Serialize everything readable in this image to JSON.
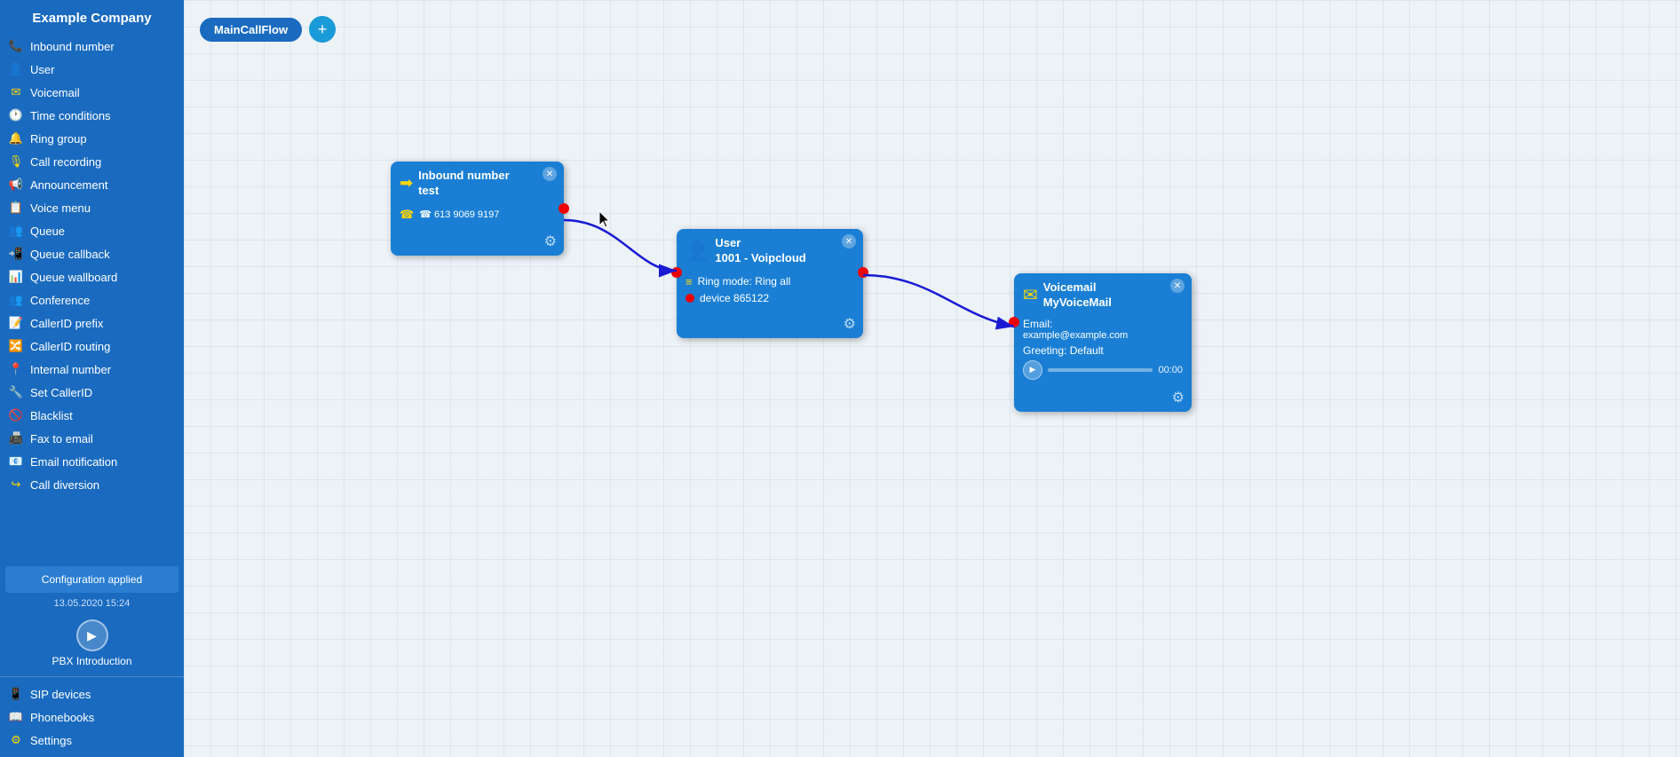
{
  "sidebar": {
    "title": "Example Company",
    "nav_items": [
      {
        "id": "inbound-number",
        "label": "Inbound number",
        "icon": "📞"
      },
      {
        "id": "user",
        "label": "User",
        "icon": "👤"
      },
      {
        "id": "voicemail",
        "label": "Voicemail",
        "icon": "✉"
      },
      {
        "id": "time-conditions",
        "label": "Time conditions",
        "icon": "🕐"
      },
      {
        "id": "ring-group",
        "label": "Ring group",
        "icon": "🔔"
      },
      {
        "id": "call-recording",
        "label": "Call recording",
        "icon": "🎙"
      },
      {
        "id": "announcement",
        "label": "Announcement",
        "icon": "📢"
      },
      {
        "id": "voice-menu",
        "label": "Voice menu",
        "icon": "📋"
      },
      {
        "id": "queue",
        "label": "Queue",
        "icon": "👥"
      },
      {
        "id": "queue-callback",
        "label": "Queue callback",
        "icon": "📲"
      },
      {
        "id": "queue-wallboard",
        "label": "Queue wallboard",
        "icon": "📊"
      },
      {
        "id": "conference",
        "label": "Conference",
        "icon": "👥"
      },
      {
        "id": "callerid-prefix",
        "label": "CallerID prefix",
        "icon": "📝"
      },
      {
        "id": "callerid-routing",
        "label": "CallerID routing",
        "icon": "🔀"
      },
      {
        "id": "internal-number",
        "label": "Internal number",
        "icon": "📍"
      },
      {
        "id": "set-callerid",
        "label": "Set CallerID",
        "icon": "🔧"
      },
      {
        "id": "blacklist",
        "label": "Blacklist",
        "icon": "🚫"
      },
      {
        "id": "fax-to-email",
        "label": "Fax to email",
        "icon": "📠"
      },
      {
        "id": "email-notification",
        "label": "Email notification",
        "icon": "📧"
      },
      {
        "id": "call-diversion",
        "label": "Call diversion",
        "icon": "↪"
      }
    ],
    "bottom_items": [
      {
        "id": "sip-devices",
        "label": "SIP devices",
        "icon": "📱"
      },
      {
        "id": "phonebooks",
        "label": "Phonebooks",
        "icon": "📖"
      },
      {
        "id": "settings",
        "label": "Settings",
        "icon": "⚙"
      }
    ],
    "config_applied": "Configuration applied",
    "config_timestamp": "13.05.2020 15:24",
    "pbx_label": "PBX Introduction"
  },
  "toolbar": {
    "flow_name": "MainCallFlow",
    "add_button_label": "+"
  },
  "nodes": {
    "inbound": {
      "title_line1": "Inbound number",
      "title_line2": "test",
      "phone": "☎ 613 9069 9197"
    },
    "user": {
      "title_line1": "User",
      "title_line2": "1001 - Voipcloud",
      "ring_mode": "Ring mode: Ring all",
      "device": "device 865122"
    },
    "voicemail": {
      "title_line1": "Voicemail",
      "title_line2": "MyVoiceMail",
      "email_label": "Email:",
      "email_value": "example@example.com",
      "greeting_label": "Greeting: Default",
      "time": "00:00"
    }
  },
  "colors": {
    "sidebar_bg": "#1a6bbf",
    "node_bg": "#1a7fd4",
    "accent_yellow": "#ffd700",
    "conn_point": "#cc0000",
    "arrow_color": "#1a1ad4"
  }
}
